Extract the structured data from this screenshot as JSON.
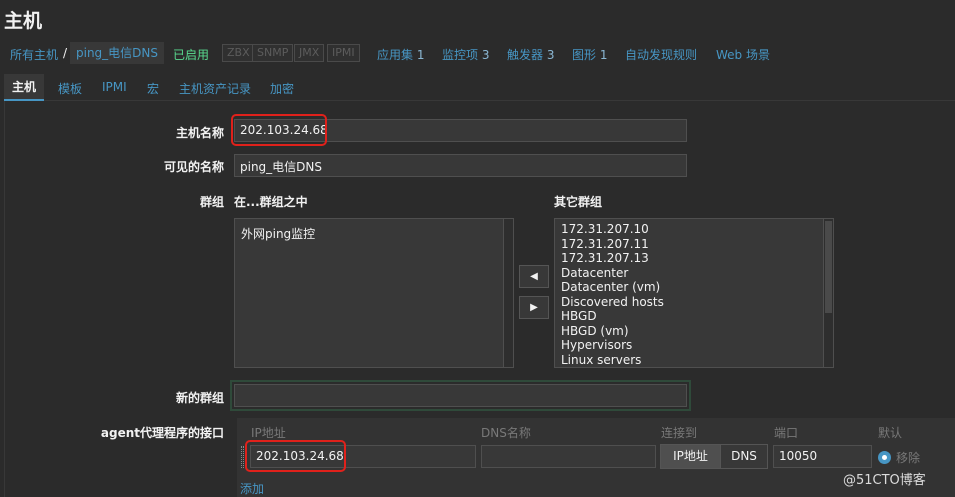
{
  "page_title": "主机",
  "breadcrumb": {
    "all_hosts": "所有主机",
    "separator": "/",
    "current_host": "ping_电信DNS",
    "status": "已启用",
    "badges": [
      "ZBX",
      "SNMP",
      "JMX",
      "IPMI"
    ],
    "links": [
      {
        "label": "应用集",
        "count": "1"
      },
      {
        "label": "监控项",
        "count": "3"
      },
      {
        "label": "触发器",
        "count": "3"
      },
      {
        "label": "图形",
        "count": "1"
      },
      {
        "label": "自动发现规则",
        "count": ""
      },
      {
        "label": "Web 场景",
        "count": ""
      }
    ]
  },
  "tabs": [
    "主机",
    "模板",
    "IPMI",
    "宏",
    "主机资产记录",
    "加密"
  ],
  "form": {
    "host_name_label": "主机名称",
    "host_name_value": "202.103.24.68",
    "visible_name_label": "可见的名称",
    "visible_name_value": "ping_电信DNS",
    "groups_label": "群组",
    "in_groups_label": "在...群组之中",
    "other_groups_label": "其它群组",
    "in_groups": [
      "外网ping监控"
    ],
    "other_groups": [
      "172.31.207.10",
      "172.31.207.11",
      "172.31.207.13",
      "Datacenter",
      "Datacenter (vm)",
      "Discovered hosts",
      "HBGD",
      "HBGD (vm)",
      "Hypervisors",
      "Linux servers"
    ],
    "move_left": "◀",
    "move_right": "▶",
    "new_group_label": "新的群组",
    "new_group_value": "",
    "agent_interface_label": "agent代理程序的接口",
    "iface_headers": {
      "ip": "IP地址",
      "dns": "DNS名称",
      "connect": "连接到",
      "port": "端口",
      "default": "默认"
    },
    "iface_ip": "202.103.24.68",
    "iface_dns": "",
    "connect_ip": "IP地址",
    "connect_dns": "DNS",
    "iface_port": "10050",
    "remove_label": "移除",
    "add_label": "添加"
  },
  "watermark": "@51CTO博客",
  "colors": {
    "accent": "#4796c4",
    "enabled": "#59db8f",
    "highlight": "#e0211b",
    "background": "#2b2b2b"
  }
}
